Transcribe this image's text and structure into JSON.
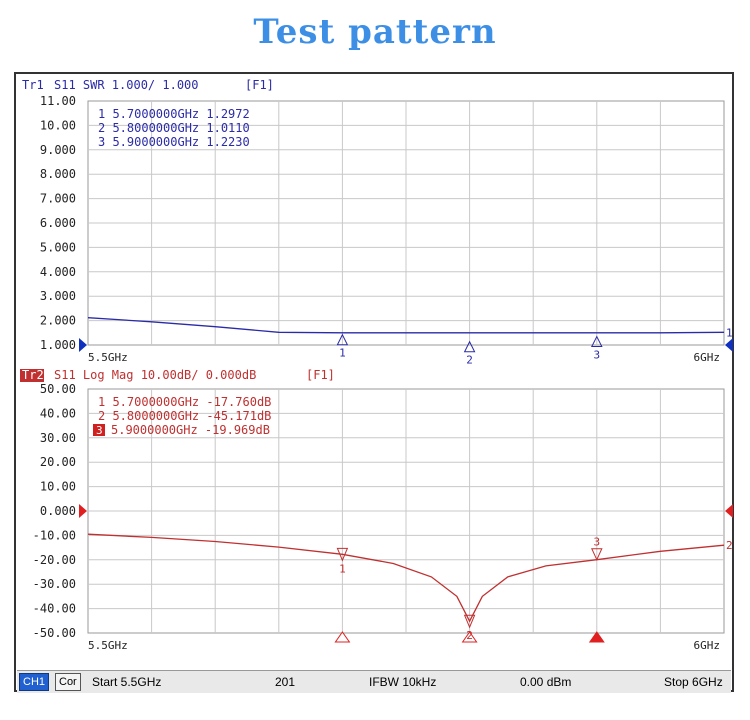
{
  "title": "Test pattern",
  "chart_data": [
    {
      "type": "line",
      "trace_label": "Tr1",
      "header": "S11  SWR 1.000/ 1.000",
      "channel_tag": "[F1]",
      "x_start_label": "5.5GHz",
      "x_stop_label": "6GHz",
      "xlim": [
        5.5,
        6.0
      ],
      "ylim": [
        1.0,
        11.0
      ],
      "yticks": [
        "11.00",
        "10.00",
        "9.000",
        "8.000",
        "7.000",
        "6.000",
        "5.000",
        "4.000",
        "3.000",
        "2.000",
        "1.000"
      ],
      "grid": true,
      "color": "#2b2ba8",
      "series": [
        {
          "x": [
            5.5,
            5.55,
            5.6,
            5.65,
            5.7,
            5.75,
            5.8,
            5.85,
            5.9,
            5.95,
            6.0
          ],
          "y": [
            2.12,
            1.95,
            1.75,
            1.52,
            1.3,
            1.12,
            1.01,
            1.09,
            1.22,
            1.36,
            1.52
          ]
        }
      ],
      "markers": [
        {
          "id": "1",
          "x": 5.7,
          "y": 1.2972,
          "label": "1  5.7000000GHz  1.2972"
        },
        {
          "id": "2",
          "x": 5.8,
          "y": 1.011,
          "label": "2  5.8000000GHz  1.0110"
        },
        {
          "id": "3",
          "x": 5.9,
          "y": 1.223,
          "label": "3  5.9000000GHz  1.2230"
        }
      ],
      "end_label": "1"
    },
    {
      "type": "line",
      "trace_label": "Tr2",
      "header": "S11  Log Mag 10.00dB/ 0.000dB",
      "channel_tag": "[F1]",
      "x_start_label": "5.5GHz",
      "x_stop_label": "6GHz",
      "xlim": [
        5.5,
        6.0
      ],
      "ylim": [
        -50.0,
        50.0
      ],
      "yticks": [
        "50.00",
        "40.00",
        "30.00",
        "20.00",
        "10.00",
        "0.000",
        "-10.00",
        "-20.00",
        "-30.00",
        "-40.00",
        "-50.00"
      ],
      "grid": true,
      "color": "#c03030",
      "series": [
        {
          "x": [
            5.5,
            5.55,
            5.6,
            5.65,
            5.7,
            5.74,
            5.77,
            5.79,
            5.8,
            5.81,
            5.83,
            5.86,
            5.9,
            5.95,
            6.0
          ],
          "y": [
            -9.5,
            -10.8,
            -12.5,
            -14.8,
            -17.76,
            -21.5,
            -27.0,
            -35.0,
            -45.171,
            -35.0,
            -27.0,
            -22.5,
            -19.969,
            -16.5,
            -14.0
          ]
        }
      ],
      "markers": [
        {
          "id": "1",
          "x": 5.7,
          "y": -17.76,
          "label": "1  5.7000000GHz  -17.760dB"
        },
        {
          "id": "2",
          "x": 5.8,
          "y": -45.171,
          "label": "2  5.8000000GHz  -45.171dB"
        },
        {
          "id": "3",
          "x": 5.9,
          "y": -19.969,
          "label": "5.9000000GHz  -19.969dB"
        }
      ],
      "end_label": "2"
    }
  ],
  "statusbar": {
    "channel": "CH1",
    "correction": "Cor",
    "start": "Start 5.5GHz",
    "points": "201",
    "ifbw": "IFBW 10kHz",
    "power": "0.00 dBm",
    "stop": "Stop 6GHz"
  }
}
